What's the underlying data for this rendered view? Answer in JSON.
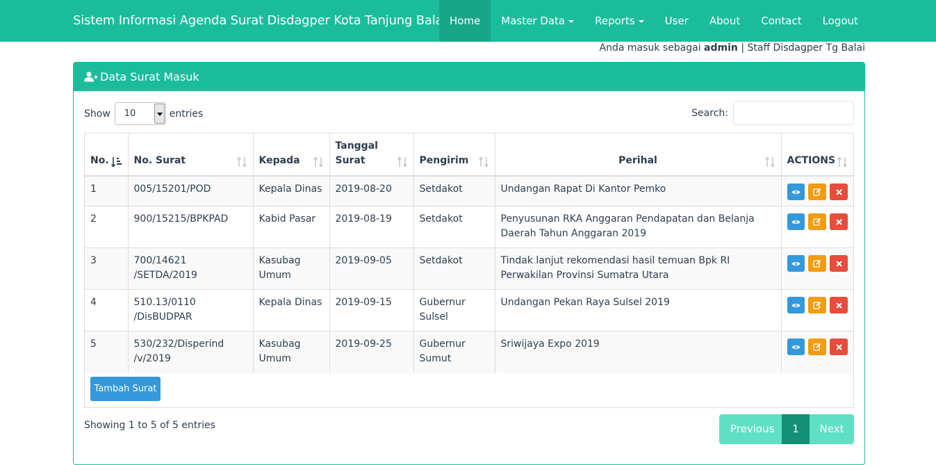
{
  "navbar": {
    "brand": "Sistem Informasi Agenda Surat Disdagper Kota Tanjung Balai",
    "items": [
      {
        "label": "Home",
        "active": true,
        "dropdown": false
      },
      {
        "label": "Master Data",
        "active": false,
        "dropdown": true
      },
      {
        "label": "Reports",
        "active": false,
        "dropdown": true
      },
      {
        "label": "User",
        "active": false,
        "dropdown": false
      },
      {
        "label": "About",
        "active": false,
        "dropdown": false
      },
      {
        "label": "Contact",
        "active": false,
        "dropdown": false
      },
      {
        "label": "Logout",
        "active": false,
        "dropdown": false
      }
    ]
  },
  "login": {
    "prefix": "Anda masuk sebagai",
    "user": "admin",
    "suffix": "| Staff Disdagper Tg Balai"
  },
  "panel": {
    "title": "Data Surat Masuk",
    "icon": "user-plus-icon"
  },
  "datatable": {
    "show_label": "Show",
    "entries_value": "10",
    "entries_label": "entries",
    "search_label": "Search:",
    "search_value": "",
    "columns": [
      "No.",
      "No. Surat",
      "Kepada",
      "Tanggal Surat",
      "Pengirim",
      "Perihal",
      "ACTIONS"
    ],
    "rows": [
      {
        "no": "1",
        "no_surat": "005/15201/POD",
        "kepada": "Kepala Dinas",
        "tanggal": "2019-08-20",
        "pengirim": "Setdakot",
        "perihal": "Undangan Rapat Di Kantor Pemko"
      },
      {
        "no": "2",
        "no_surat": "900/15215/BPKPAD",
        "kepada": "Kabid Pasar",
        "tanggal": "2019-08-19",
        "pengirim": "Setdakot",
        "perihal": "Penyusunan RKA Anggaran Pendapatan dan Belanja Daerah Tahun Anggaran 2019"
      },
      {
        "no": "3",
        "no_surat": "700/14621 /SETDA/2019",
        "kepada": "Kasubag Umum",
        "tanggal": "2019-09-05",
        "pengirim": "Setdakot",
        "perihal": "Tindak lanjut rekomendasi hasil temuan Bpk RI Perwakilan Provinsi Sumatra Utara"
      },
      {
        "no": "4",
        "no_surat": "510.13/0110 /DisBUDPAR",
        "kepada": "Kepala Dinas",
        "tanggal": "2019-09-15",
        "pengirim": "Gubernur Sulsel",
        "perihal": "Undangan Pekan Raya Sulsel 2019"
      },
      {
        "no": "5",
        "no_surat": "530/232/Disperind /v/2019",
        "kepada": "Kasubag Umum",
        "tanggal": "2019-09-25",
        "pengirim": "Gubernur Sumut",
        "perihal": "Sriwijaya Expo 2019"
      }
    ],
    "add_button": "Tambah Surat",
    "info": "Showing 1 to 5 of 5 entries",
    "pagination": {
      "previous": "Previous",
      "current": "1",
      "next": "Next"
    }
  },
  "colors": {
    "primary": "#1abc9c",
    "active_nav": "#17a689",
    "view": "#3498db",
    "edit": "#f39c12",
    "delete": "#e74c3c"
  }
}
